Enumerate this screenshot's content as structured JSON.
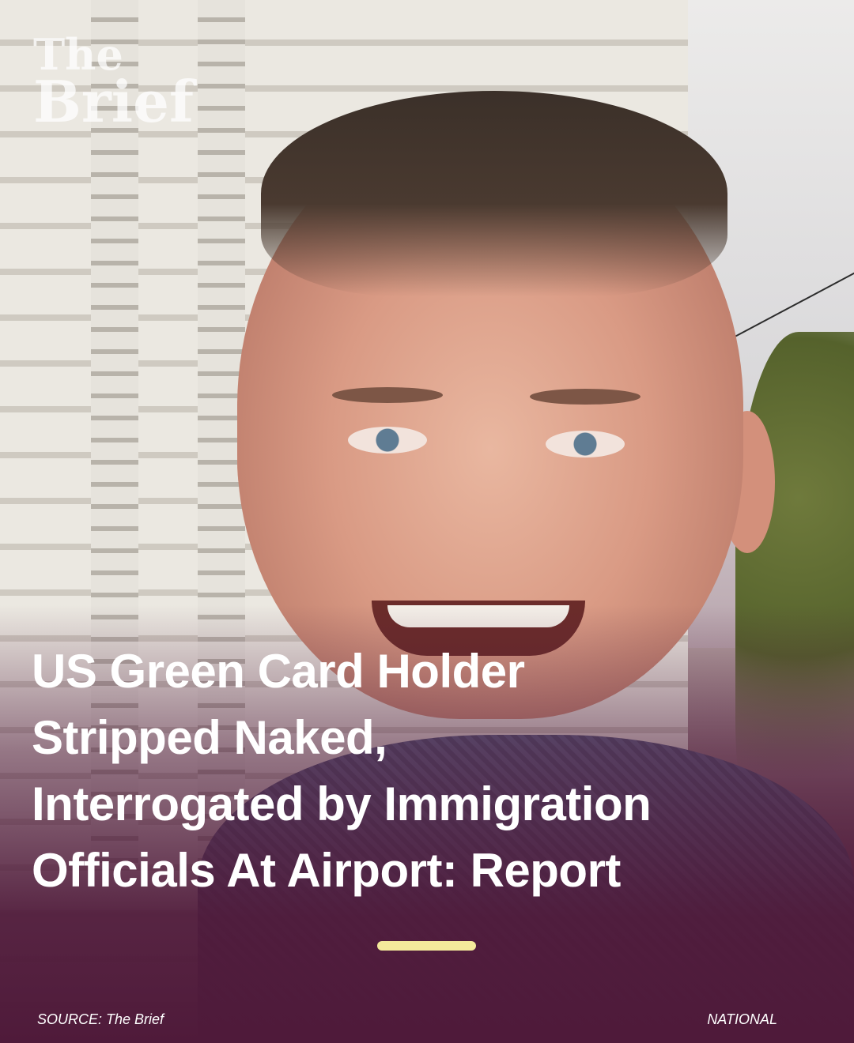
{
  "logo": {
    "line1": "The",
    "line2": "Brief"
  },
  "headline": {
    "lines": [
      "US Green Card Holder",
      "Stripped Naked,",
      "Interrogated by Immigration",
      "Officials At Airport: Report"
    ]
  },
  "footer": {
    "source": "SOURCE: The Brief",
    "category": "NATIONAL"
  },
  "colors": {
    "overlay": "#4f1a3a",
    "divider": "#f4ea9b",
    "text": "#ffffff"
  }
}
